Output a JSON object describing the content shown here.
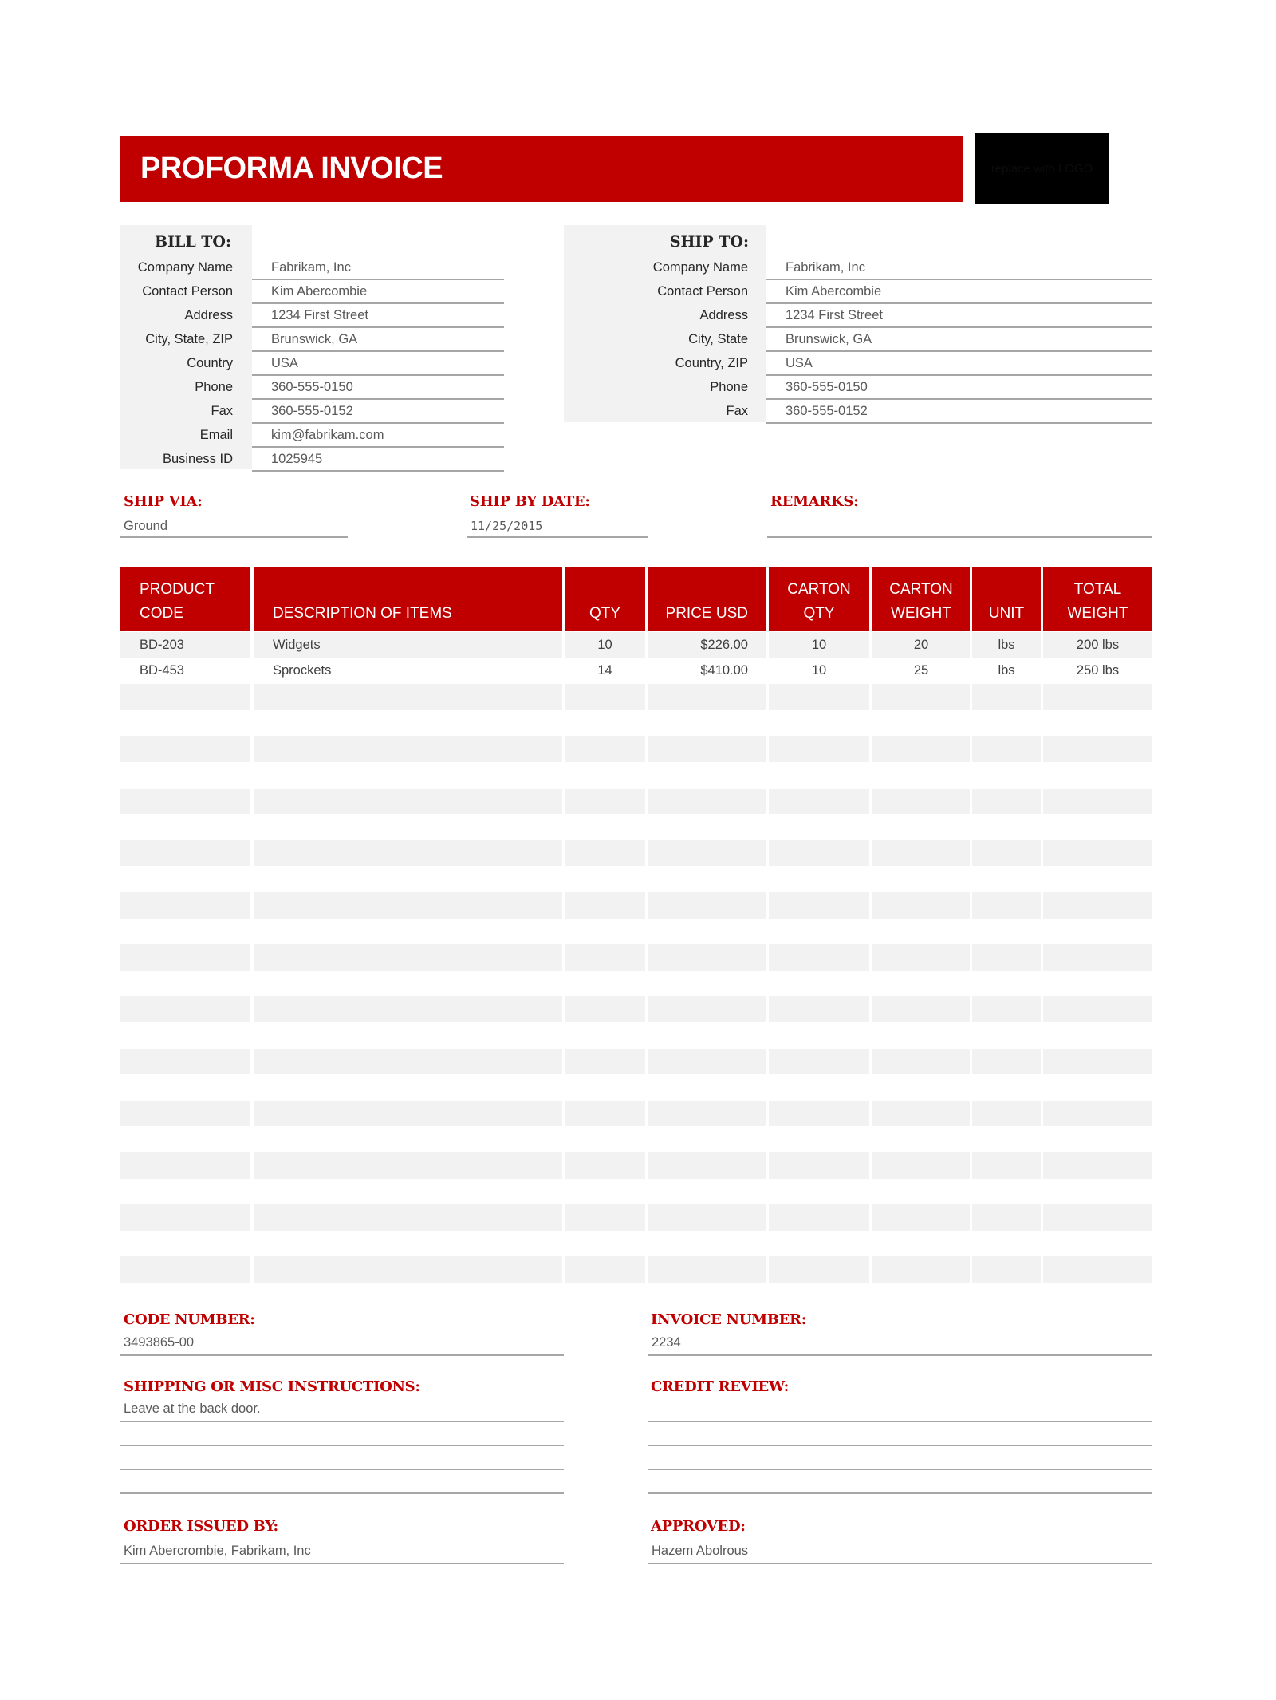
{
  "header": {
    "title": "PROFORMA INVOICE",
    "logo_placeholder": "replace with LOGO",
    "accent_color": "#c00000"
  },
  "bill_to": {
    "heading": "BILL TO:",
    "fields": [
      {
        "label": "Company Name",
        "value": "Fabrikam, Inc"
      },
      {
        "label": "Contact Person",
        "value": "Kim Abercombie"
      },
      {
        "label": "Address",
        "value": "1234 First Street"
      },
      {
        "label": "City, State, ZIP",
        "value": "Brunswick, GA"
      },
      {
        "label": "Country",
        "value": "USA"
      },
      {
        "label": "Phone",
        "value": "360-555-0150"
      },
      {
        "label": "Fax",
        "value": "360-555-0152"
      },
      {
        "label": "Email",
        "value": "kim@fabrikam.com"
      },
      {
        "label": "Business ID",
        "value": "1025945"
      }
    ]
  },
  "ship_to": {
    "heading": "SHIP TO:",
    "fields": [
      {
        "label": "Company Name",
        "value": "Fabrikam, Inc"
      },
      {
        "label": "Contact Person",
        "value": "Kim Abercombie"
      },
      {
        "label": "Address",
        "value": "1234 First Street"
      },
      {
        "label": "City, State",
        "value": "Brunswick, GA"
      },
      {
        "label": "Country, ZIP",
        "value": "USA"
      },
      {
        "label": "Phone",
        "value": "360-555-0150"
      },
      {
        "label": "Fax",
        "value": "360-555-0152"
      }
    ]
  },
  "shipping": {
    "ship_via_label": "SHIP VIA:",
    "ship_via_value": "Ground",
    "ship_by_date_label": "SHIP BY DATE:",
    "ship_by_date_value": "11/25/2015",
    "remarks_label": "REMARKS:",
    "remarks_value": ""
  },
  "table": {
    "columns": [
      {
        "line1": "PRODUCT",
        "line2": "CODE"
      },
      {
        "line1": "",
        "line2": "DESCRIPTION OF ITEMS"
      },
      {
        "line1": "",
        "line2": "QTY"
      },
      {
        "line1": "",
        "line2": "PRICE USD"
      },
      {
        "line1": "CARTON",
        "line2": "QTY"
      },
      {
        "line1": "CARTON",
        "line2": "WEIGHT"
      },
      {
        "line1": "",
        "line2": "UNIT"
      },
      {
        "line1": "TOTAL",
        "line2": "WEIGHT"
      }
    ],
    "rows": [
      [
        "BD-203",
        "Widgets",
        "10",
        "$226.00",
        "10",
        "20",
        "lbs",
        "200 lbs"
      ],
      [
        "BD-453",
        "Sprockets",
        "14",
        "$410.00",
        "10",
        "25",
        "lbs",
        "250 lbs"
      ]
    ],
    "empty_row_count": 23
  },
  "footer": {
    "code_number_label": "CODE NUMBER:",
    "code_number_value": "3493865-00",
    "invoice_number_label": "INVOICE NUMBER:",
    "invoice_number_value": "2234",
    "instructions_label": "SHIPPING OR MISC INSTRUCTIONS:",
    "instructions_lines": [
      "Leave at the back door.",
      "",
      "",
      ""
    ],
    "credit_review_label": "CREDIT REVIEW:",
    "credit_review_lines": [
      "",
      "",
      "",
      ""
    ],
    "order_issued_by_label": "ORDER ISSUED BY:",
    "order_issued_by_value": "Kim Abercrombie, Fabrikam, Inc",
    "approved_label": "APPROVED:",
    "approved_value": "Hazem Abolrous"
  }
}
